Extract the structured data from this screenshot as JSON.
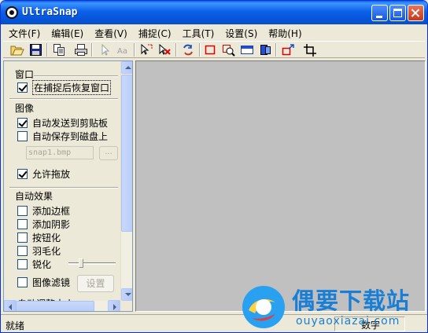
{
  "window": {
    "title": "UltraSnap"
  },
  "menu": [
    "文件(F)",
    "编辑(E)",
    "查看(V)",
    "捕捉(C)",
    "工具(T)",
    "设置(S)",
    "帮助(H)"
  ],
  "toolbar": {
    "icons": [
      "open-icon",
      "save-icon",
      "copy-icon",
      "print-icon",
      "pointer-icon",
      "text-icon",
      "select-icon",
      "delete-selection-icon",
      "refresh-icon",
      "capture-rectangle-icon",
      "capture-region-icon",
      "capture-window-icon",
      "capture-object-icon",
      "capture-menu-icon",
      "crop-icon"
    ]
  },
  "panel": {
    "window_group": {
      "title": "窗口",
      "restore_after_capture": {
        "label": "在捕捉后恢复窗口",
        "checked": true
      }
    },
    "image_group": {
      "title": "图像",
      "send_to_clipboard": {
        "label": "自动发送到剪贴板",
        "checked": true
      },
      "save_to_disk": {
        "label": "自动保存到磁盘上",
        "checked": false
      },
      "filename": "snap1.bmp",
      "browse_label": "...",
      "allow_drag": {
        "label": "允许拖放",
        "checked": true
      }
    },
    "effects_group": {
      "title": "自动效果",
      "add_border": {
        "label": "添加边框",
        "checked": false
      },
      "add_shadow": {
        "label": "添加阴影",
        "checked": false
      },
      "button_effect": {
        "label": "按钮化",
        "checked": false
      },
      "feather": {
        "label": "羽毛化",
        "checked": false
      },
      "sharpen": {
        "label": "锐化",
        "checked": false
      },
      "image_filter": {
        "label": "图像滤镜",
        "checked": false
      },
      "settings_label": "设置",
      "next_group_partial": "自动调整大小"
    }
  },
  "status": {
    "text": "就绪",
    "numlock": "数字"
  },
  "watermark": {
    "title": "偶要下载站",
    "url": "ouyaoxiazai.com"
  },
  "colors": {
    "title_bar": "#0554d8",
    "canvas": "#c0c0c0",
    "watermark": "#1a7fd4"
  }
}
